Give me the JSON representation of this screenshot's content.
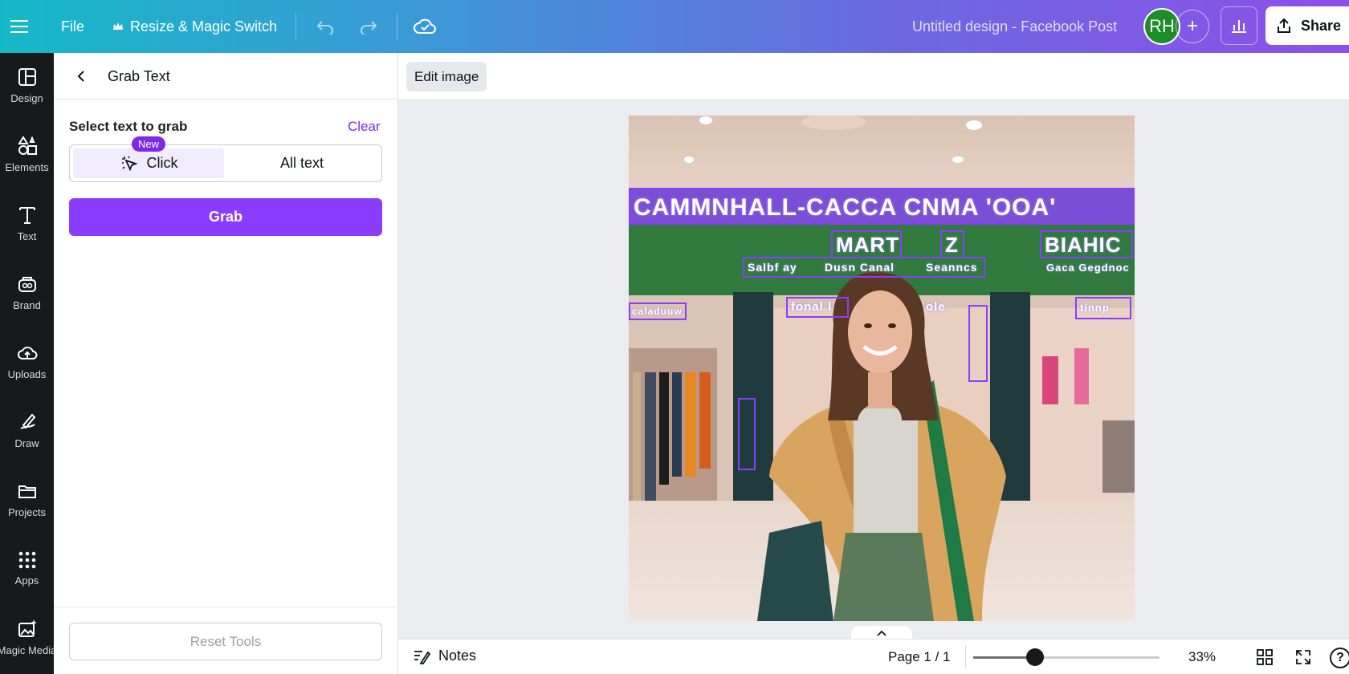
{
  "topbar": {
    "file_label": "File",
    "resize_label": "Resize & Magic Switch",
    "doc_title": "Untitled design - Facebook Post",
    "avatar_initials": "RH",
    "share_label": "Share"
  },
  "rail": {
    "items": [
      {
        "label": "Design",
        "icon": "design-icon"
      },
      {
        "label": "Elements",
        "icon": "elements-icon"
      },
      {
        "label": "Text",
        "icon": "text-icon"
      },
      {
        "label": "Brand",
        "icon": "brand-icon"
      },
      {
        "label": "Uploads",
        "icon": "uploads-icon"
      },
      {
        "label": "Draw",
        "icon": "draw-icon"
      },
      {
        "label": "Projects",
        "icon": "projects-icon"
      },
      {
        "label": "Apps",
        "icon": "apps-icon"
      },
      {
        "label": "Magic Media",
        "icon": "magic-media-icon"
      }
    ]
  },
  "panel": {
    "title": "Grab Text",
    "select_label": "Select text to grab",
    "clear_label": "Clear",
    "new_badge": "New",
    "click_label": "Click",
    "all_text_label": "All text",
    "grab_label": "Grab",
    "reset_label": "Reset Tools"
  },
  "context": {
    "edit_image_label": "Edit image"
  },
  "canvas": {
    "signs": {
      "banner": "CAMMNHALL-CACCA CNMA 'OOA'",
      "mart": "MART",
      "z": "Z",
      "right_sign": "BIAHIC",
      "sub1": "Salbf ay",
      "sub2": "Dusn Canal",
      "sub3": "Seanncs",
      "right_sub": "Gaca Gegdnoc",
      "left_small": "caladuuw",
      "mid_sign": "fonal l",
      "mid_sign2": "ole",
      "right_small": "tinnp"
    }
  },
  "bottombar": {
    "notes_label": "Notes",
    "page_indicator": "Page 1 / 1",
    "zoom_value": "33%",
    "zoom_fraction": 0.33,
    "help_label": "?"
  },
  "colors": {
    "accent": "#8b3dff",
    "link": "#7d2ae8",
    "rail_bg": "#18191b"
  }
}
